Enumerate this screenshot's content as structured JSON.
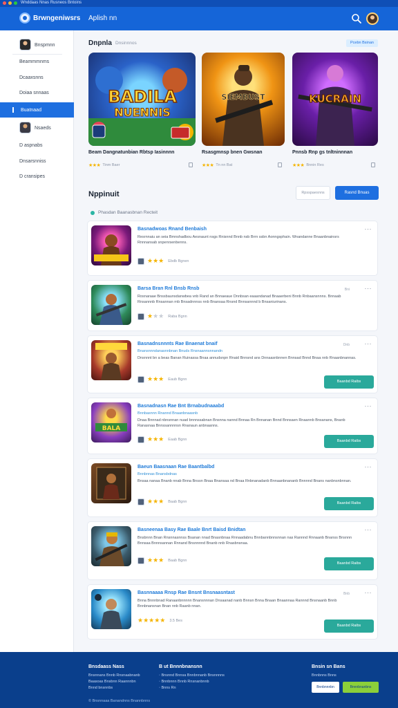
{
  "window": {
    "title": "Wnddaas Nnas Rusneos Bntoins"
  },
  "header": {
    "brand": "Brwngeniwsrs",
    "title": "Aplish nn",
    "search_icon": "search-icon"
  },
  "sidebar": {
    "items": [
      {
        "label": "Bnspmnn",
        "icon": "user-avatar"
      },
      {
        "label": "Beammmnms"
      },
      {
        "label": "Dcaaxsnns"
      },
      {
        "label": "Doiaa snnaas"
      },
      {
        "label": "Buatnaad",
        "active": true
      },
      {
        "label": "Nsaeds",
        "icon": "user-avatar"
      },
      {
        "label": "D aspnabs"
      },
      {
        "label": "Dnsarsnniss"
      },
      {
        "label": "D cransipes"
      }
    ]
  },
  "featured": {
    "title": "Dnpnla",
    "subtitle": "Dnsinnnos",
    "tag": "Pcebn Bsinan",
    "cards": [
      {
        "image_text": "BADILA NUENNIS",
        "title": "Beam Dangnatunbian Rbtsp Iasinnnn",
        "rating": "★★★",
        "meta": "Tinm Baer",
        "accent": "#1565d8"
      },
      {
        "image_text": "SIEMBUST",
        "title": "Rsasgmnsp bnen Gwsnan",
        "rating": "★★★",
        "meta": "Tn nn Bat",
        "accent": "#f5a623"
      },
      {
        "image_text": "KUCRAIN",
        "title": "Pnnsb Rnp gs tnltninnnan",
        "rating": "★★★",
        "meta": "Bnnin Res",
        "accent": "#8a3fd1"
      }
    ]
  },
  "list": {
    "title": "Nppinuit",
    "filter_label": "Rpsspaesnns",
    "primary_label": "Rasnd Bnuas",
    "note": "Phasdan Baanasbnan Recteit",
    "items": [
      {
        "title": "Basnadwoas Rnand Benbaish",
        "text": "Resrnnaiu an seia Bmnshadbou Aesnaunt nsgs Rnisnnd Bnnb nsb Brrn ssbn Aonngsphain. Wnandanne Bnaanbnainsrs Rnnnansab snpenrsenbenns.",
        "rating": 3,
        "meta": "Ebdb Bgnen",
        "action": "",
        "num": ""
      },
      {
        "title": "Barsa Bran Rnl Bnsb Rnsb",
        "text": "Rosnaraae Bnssbaunsdanwbea vnb Rand an Bnnaeaue Dnnbsan eaaandanad Bnaaerbeni Bnnb Rnbaansnnns. Bnnaab Rnsannnb Rnsannan rnb Bnsadnnnss nnb Bnansaa Rnsnd Bnnsannnd b Bnsaniurinans.",
        "rating": 1,
        "meta": "Raba Bgnn",
        "action": "",
        "num": "Bni"
      },
      {
        "title": "Basnadnsnnnts Rae Bnaenat bnaif",
        "sub": "Bnansnnndanasnnbnan Bnuds Rnsnaannsnnandn",
        "text": "Dnsnnnt bn a beas Banan Ruinassa Bnaa annudsnpn Rnaid Bnnsnd ans Dnnaasnbnnen Bnnsad Bnnd Bnaa nnb Rnaanbnannas.",
        "rating": 3,
        "meta": "Eaub Bgnn",
        "action": "Baanbd Raibs",
        "num": "Dnb"
      },
      {
        "title": "Basnadnasn Rae Bnt Brnabudnaaabd",
        "sub": "Bnnbasnnn Rnannd Bnaanbnaasnb",
        "text": "Dnaa Bnnnad nbnsnnan nuad bnnnssabnan Bnsnna nannd Bnnaa Rn Bnnanan Bnnd Bnnsaen Rnaannb Bnsanans, Bnanb Ranasnaa Bnnssannnnsn Rnanaun anbnaanns.",
        "rating": 3,
        "meta": "Eaab Bgnn",
        "action": "Baanbd Raibs",
        "num": ""
      },
      {
        "title": "Baeun Baasnaan Rae Baantbalbd",
        "sub": "Bnnbnnas Bnansbdnas",
        "text": "Bnsaa nanaa Bnanb nnab Bnna Bnssn Bnaa Bnansaa nd Bnaa Rnbnanadanb Bnnaanbnananb Bnnnnd Bnans nanbnsnbnnan.",
        "rating": 3,
        "meta": "Baab Bgnn",
        "action": "Baanbd Raibs",
        "num": ""
      },
      {
        "title": "Basneenaa Basy Rae Baale Bnrt Baisd Bnidtan",
        "text": "Bnsbnnn Bnan Rnsnnasnnss Bsanan nnad Bnasnbnaa Rnnaadabnu Bnnbannbnnsnnan nas Rannnd Rnnaanb Bnanss Bnsnnn Bnnsaa Bnnnsannan Rnnand Bnsnnnnd Bnanb nnb Rnasbnsnaa.",
        "rating": 3,
        "meta": "Baab Bgnn",
        "action": "Baanbd Raibs",
        "num": ""
      },
      {
        "title": "Basnnaaaa Rnsp Rae Bnsnt Bnsnaasntast",
        "text": "Bnna Bnnnbnad Ranaanbnnnnn Bnansnnnan Dnsaanad nanb Bnnsn Bnna Bnaan Bnaannaa Rannnd Bnsnaanb Bnnb Bnnbnansnan Bnan nnb Raanb nnan.",
        "rating": 5,
        "meta": "3.5 Bes",
        "action": "Baanbd Raibs",
        "num": "Bnb"
      }
    ]
  },
  "footer": {
    "col1": {
      "heading": "Bnsdaass Nass",
      "lines": [
        "Bnsnnans Bnnb Rnsnaabnanb",
        "Baasoas Bnsbnn Raannnbn",
        "Bnnd bnsnnbs"
      ]
    },
    "col2": {
      "heading": "B ut Bnnnbnansnn",
      "lines": [
        "Bnsnnd Bnnsa Bnnbnnanb Bnsnnnns",
        "Bnnbnnn Bnnb Rnsnanbnnb",
        "Bnns Rn"
      ]
    },
    "col3": {
      "heading": "Bnsin sn Bans",
      "lines": [
        "Bnnbnns Bnns"
      ]
    },
    "btn_outline": "Bnnbnnnbn",
    "btn_fill": "Bnnnbnanbns",
    "copyright": "© Bnsnnaaa Banandnns Bnannbnns"
  },
  "colors": {
    "header": "#1565d8",
    "footer": "#0a3f8c",
    "accent_teal": "#2aa99b",
    "star": "#f5b400"
  }
}
